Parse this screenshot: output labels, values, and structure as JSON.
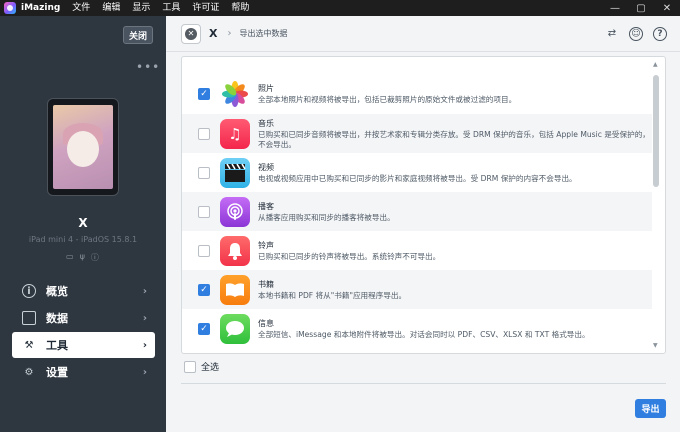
{
  "titlebar": {
    "app_name": "iMazing",
    "menus": [
      "文件",
      "编辑",
      "显示",
      "工具",
      "许可证",
      "帮助"
    ],
    "controls": [
      "—",
      "▢",
      "✕"
    ]
  },
  "sidebar": {
    "close_label": "关闭",
    "more_label": "•••",
    "device_name": "X",
    "device_sub": "iPad mini 4 - iPadOS 15.8.1",
    "nav": [
      {
        "label": "概览",
        "icon": "info-icon",
        "glyph": "i"
      },
      {
        "label": "数据",
        "icon": "data-icon",
        "glyph": ""
      },
      {
        "label": "工具",
        "icon": "tools-icon",
        "glyph": "⚒"
      },
      {
        "label": "设置",
        "icon": "gear-icon",
        "glyph": "⚙"
      }
    ],
    "active_index": 2
  },
  "main": {
    "breadcrumb": {
      "device": "X",
      "separator": "›",
      "page": "导出选中数据"
    },
    "items": [
      {
        "title": "照片",
        "desc": "全部本地照片和视频将被导出，包括已裁剪照片的原始文件或被过滤的项目。",
        "checked": true
      },
      {
        "title": "音乐",
        "desc": "已购买和已同步音频将被导出，并按艺术家和专辑分类存放。受 DRM 保护的音乐，包括 Apple Music 是受保护的，不会导出。",
        "checked": false
      },
      {
        "title": "视频",
        "desc": "电视或视频应用中已购买和已同步的影片和家庭视频将被导出。受 DRM 保护的内容不会导出。",
        "checked": false
      },
      {
        "title": "播客",
        "desc": "从播客应用购买和同步的播客将被导出。",
        "checked": false
      },
      {
        "title": "铃声",
        "desc": "已购买和已同步的铃声将被导出。系统铃声不可导出。",
        "checked": false
      },
      {
        "title": "书籍",
        "desc": "本地书籍和 PDF 将从\"书籍\"应用程序导出。",
        "checked": true
      },
      {
        "title": "信息",
        "desc": "全部短信、iMessage 和本地附件将被导出。对话会同时以 PDF、CSV、XLSX 和 TXT 格式导出。",
        "checked": true
      }
    ],
    "select_all_label": "全选",
    "export_label": "导出"
  },
  "colors": {
    "accent": "#2f7ee0",
    "sidebar": "#2e3640"
  }
}
